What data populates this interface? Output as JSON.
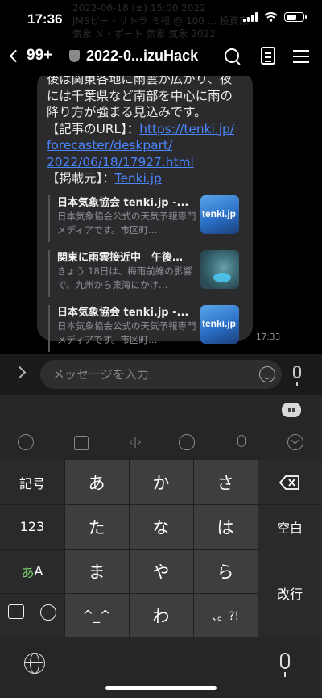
{
  "status_bar": {
    "time": "17:36"
  },
  "background_ghost": {
    "line1": "2022-06-18 (±) 15:00 2022",
    "line2": "JMSピー・サトラ ミ報 @ 100 ... 投資家",
    "line3": "気象 メ・ポート 気象 気象 2022"
  },
  "nav": {
    "back_count": "99+",
    "title": "2022-0...izuHack",
    "icons": [
      "search-icon",
      "notes-icon",
      "menu-icon"
    ]
  },
  "message": {
    "text_lines": [
      "後は関東各地に雨雲が広がり、夜",
      "には千葉県など南部を中心に雨の",
      "降り方が強まる見込みです。"
    ],
    "url_label": "【記事のURL】：",
    "url_line1": "https://tenki.jp/",
    "url_line2": "forecaster/deskpart/",
    "url_line3": "2022/06/18/17927.html",
    "source_label": "【掲載元】：",
    "source_link": "Tenki.jp",
    "time": "17:33"
  },
  "previews": [
    {
      "title": "日本気象協会 tenki.jp -...",
      "desc": "日本気象協会公式の天気予報専門メディアです。市区町…",
      "thumb": "tenki.jp"
    },
    {
      "title": "関東に雨雲接近中　午後…",
      "desc": "きょう 18日は、梅雨前線の影響で、九州から東海にかけ…",
      "thumb": ""
    },
    {
      "title": "日本気象協会 tenki.jp -...",
      "desc": "日本気象協会公式の天気予報専門メディアです。市区町…",
      "thumb": "tenki.jp"
    }
  ],
  "input": {
    "placeholder": "メッセージを入力"
  },
  "keyboard": {
    "left": {
      "symbols": "記号",
      "numbers": "123",
      "kana_a": "あ",
      "kana_A": "A"
    },
    "rows": [
      [
        "あ",
        "か",
        "さ"
      ],
      [
        "た",
        "な",
        "は"
      ],
      [
        "ま",
        "や",
        "ら"
      ],
      [
        "^_^",
        "わ",
        "、。?!"
      ]
    ],
    "right": {
      "space": "空白",
      "enter": "改行"
    }
  }
}
